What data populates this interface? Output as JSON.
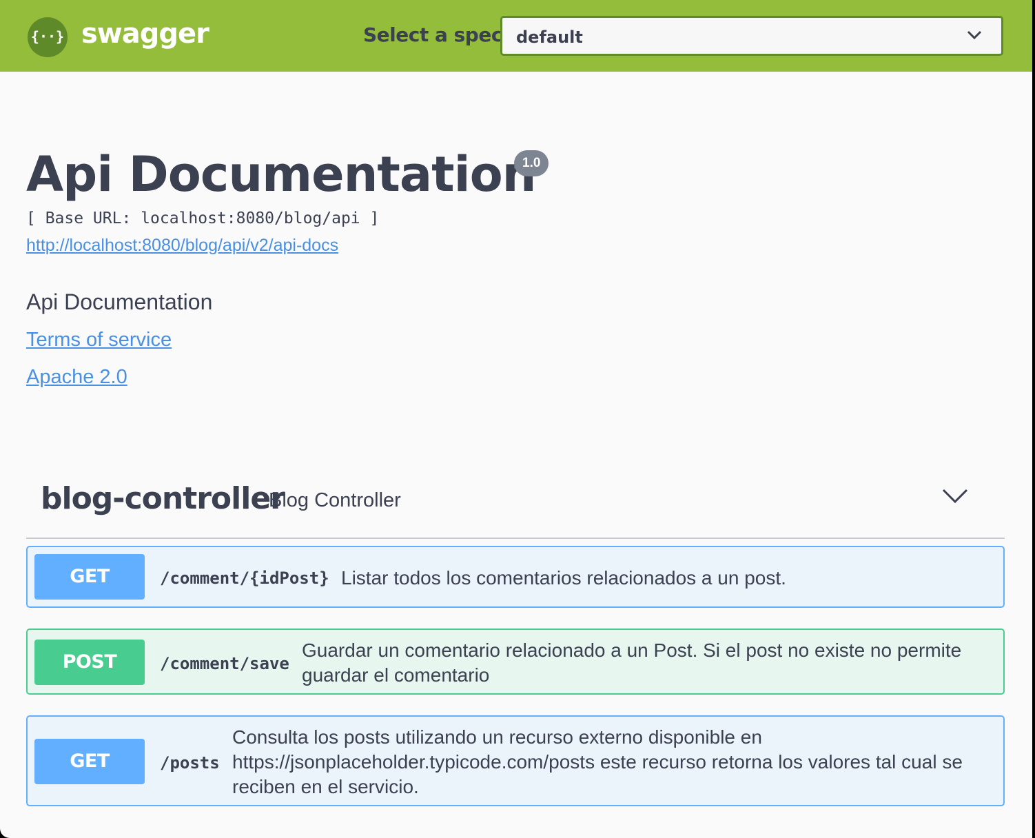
{
  "header": {
    "logo_glyph": "{··}",
    "brand": "swagger",
    "spec_label": "Select a spec",
    "spec_value": "default"
  },
  "info": {
    "title": "Api Documentation",
    "version": "1.0",
    "base_url": "[ Base URL: localhost:8080/blog/api ]",
    "docs_link": "http://localhost:8080/blog/api/v2/api-docs",
    "description": "Api Documentation",
    "terms": "Terms of service",
    "license": "Apache 2.0"
  },
  "tag": {
    "name": "blog-controller",
    "description": "Blog Controller"
  },
  "operations": [
    {
      "method": "GET",
      "path": "/comment/{idPost}",
      "summary": "Listar todos los comentarios relacionados a un post."
    },
    {
      "method": "POST",
      "path": "/comment/save",
      "summary": "Guardar un comentario relacionado a un Post. Si el post no existe no permite guardar el comentario"
    },
    {
      "method": "GET",
      "path": "/posts",
      "summary": "Consulta los posts utilizando un recurso externo disponible en https://jsonplaceholder.typicode.com/posts este recurso retorna los valores tal cual se reciben en el servicio."
    }
  ],
  "colors": {
    "topbar": "#94bd3b",
    "get": "#61affe",
    "post": "#49cc90",
    "link": "#4990e2",
    "text": "#3b4151"
  }
}
